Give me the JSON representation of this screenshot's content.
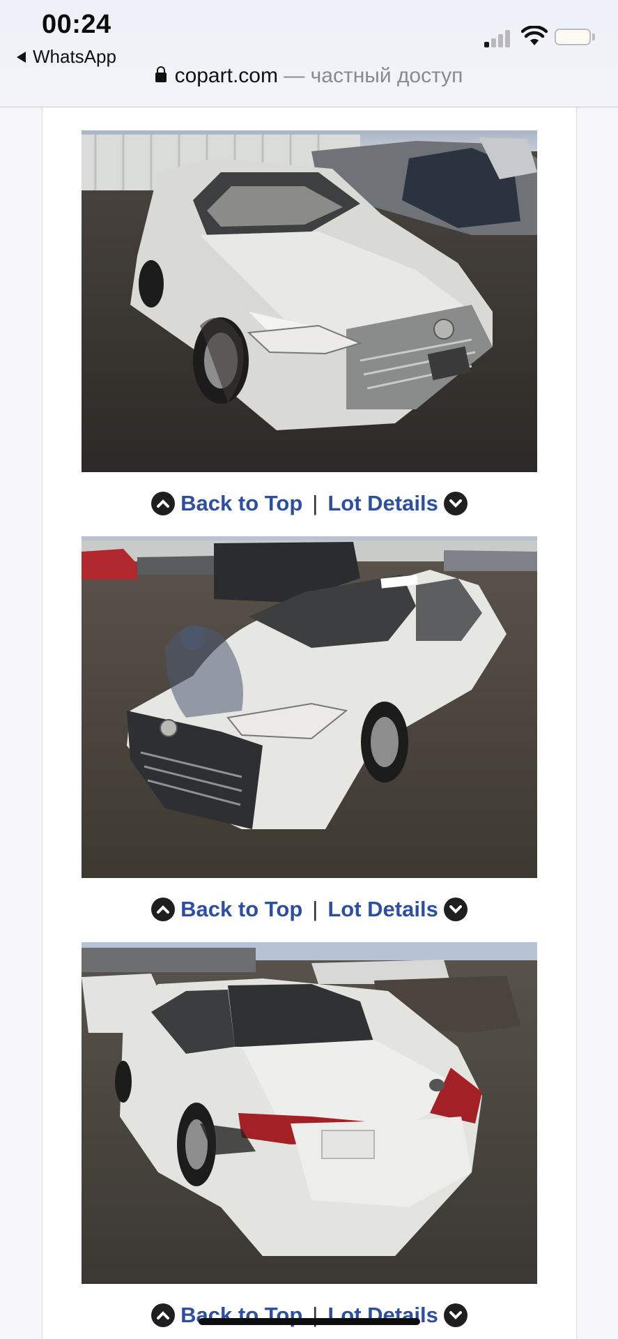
{
  "status_bar": {
    "time": "00:24",
    "back_app": "WhatsApp"
  },
  "browser": {
    "domain": "copart.com",
    "separator": "—",
    "mode_label": "частный доступ"
  },
  "photos": [
    {
      "view": "front-right",
      "car_color": "#d9d9d6"
    },
    {
      "view": "front-left",
      "car_color": "#e6e6e3"
    },
    {
      "view": "rear-left",
      "car_color": "#e3e3e0"
    }
  ],
  "nav": {
    "back_to_top": "Back to Top",
    "separator": "|",
    "lot_details": "Lot Details"
  },
  "colors": {
    "link": "#2d4f9e",
    "icon_bg": "#1f1f1f"
  }
}
